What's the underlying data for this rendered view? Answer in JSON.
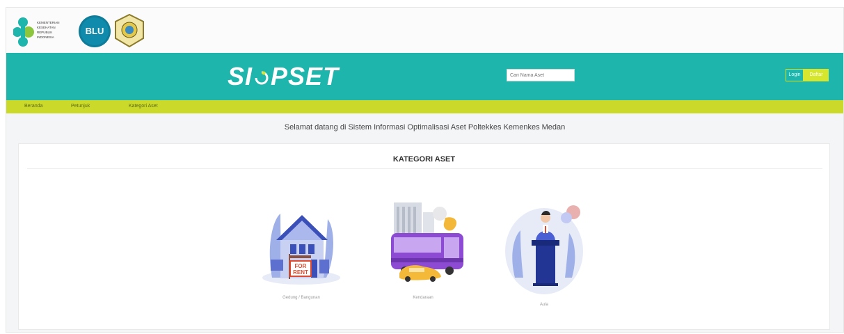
{
  "logos": {
    "kemenkes_text": [
      "KEMENTERIAN",
      "KESEHATAN",
      "REPUBLIK",
      "INDONESIA"
    ],
    "blu_text": "BLU"
  },
  "header": {
    "brand_left": "SI",
    "brand_right": "PSET",
    "search_placeholder": "Cari Nama Aset",
    "login_label": "Login",
    "daftar_label": "Daftar",
    "bg_color": "#1db5ac",
    "accent_color": "#d6e52d"
  },
  "nav": {
    "items": [
      "Beranda",
      "Petunjuk",
      "Kategori Aset"
    ],
    "bg_color": "#cbd92a"
  },
  "welcome_text": "Selamat datang di Sistem Informasi Optimalisasi Aset Poltekkes Kemenkes Medan",
  "card": {
    "title": "KATEGORI ASET",
    "categories": [
      {
        "label": "Gedung / Bangunan",
        "icon": "house-for-rent-icon",
        "sign": [
          "FOR",
          "RENT"
        ]
      },
      {
        "label": "Kendaraan",
        "icon": "bus-city-icon"
      },
      {
        "label": "Aula",
        "icon": "speaker-podium-icon"
      }
    ]
  }
}
